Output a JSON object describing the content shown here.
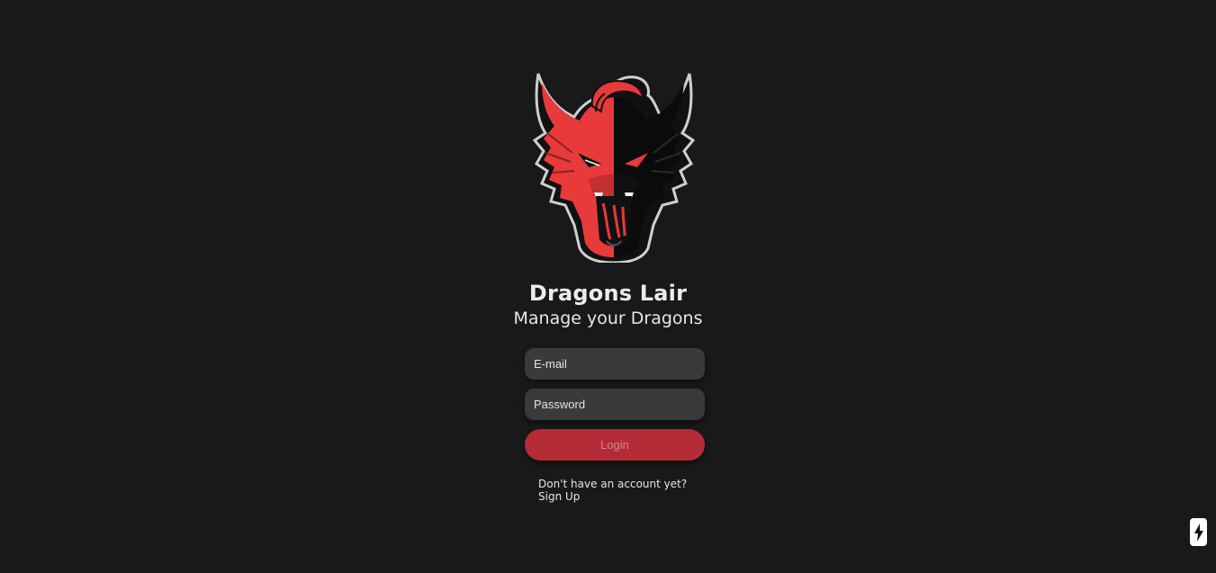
{
  "app": {
    "title": "Dragons Lair",
    "subtitle": "Manage your Dragons"
  },
  "login_form": {
    "email_placeholder": "E-mail",
    "password_placeholder": "Password",
    "login_label": "Login"
  },
  "signup": {
    "prompt": "Don't have an account yet?",
    "link_label": "Sign Up"
  },
  "icons": {
    "logo": "dragon-head-logo",
    "corner_button": "lightning-bolt-icon"
  },
  "colors": {
    "background": "#19191b",
    "accent": "#b52b35",
    "dragon_red": "#e83a3a",
    "field_background": "#3a3a3d"
  }
}
